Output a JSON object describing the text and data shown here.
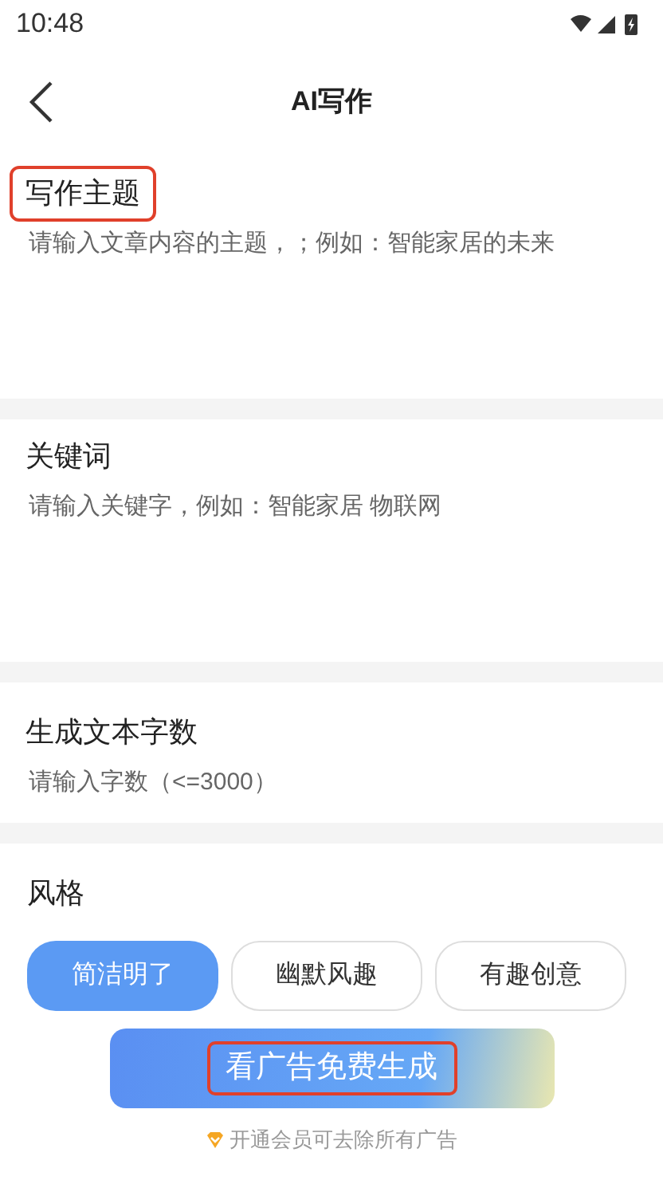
{
  "status_bar": {
    "time": "10:48"
  },
  "header": {
    "title": "AI写作"
  },
  "fields": [
    {
      "label": "写作主题",
      "placeholder": "请输入文章内容的主题，；例如：智能家居的未来",
      "highlighted": true,
      "kind": "area"
    },
    {
      "label": "关键词",
      "placeholder": "请输入关键字，例如：智能家居 物联网",
      "highlighted": false,
      "kind": "area"
    },
    {
      "label": "生成文本字数",
      "placeholder": "请输入字数（<=3000）",
      "highlighted": false,
      "kind": "line"
    }
  ],
  "style": {
    "label": "风格",
    "options": [
      {
        "label": "简洁明了",
        "selected": true
      },
      {
        "label": "幽默风趣",
        "selected": false
      },
      {
        "label": "有趣创意",
        "selected": false
      }
    ]
  },
  "generate_button": {
    "label": "看广告免费生成",
    "highlighted": true
  },
  "vip_note": "开通会员可去除所有广告"
}
